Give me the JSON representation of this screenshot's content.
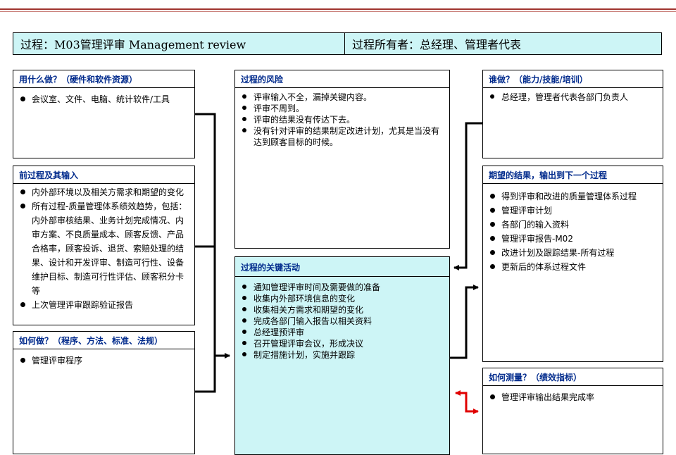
{
  "header": {
    "process": "过程：M03管理评审 Management review",
    "owner": "过程所有者：总经理、管理者代表"
  },
  "boxes": {
    "resources": {
      "title": "用什么做？（硬件和软件资源）",
      "items": [
        "会议室、文件、电脑、统计软件/工具"
      ]
    },
    "inputs": {
      "title": "前过程及其输入",
      "items": [
        "内外部环境以及相关方需求和期望的变化",
        "所有过程-质量管理体系绩效趋势，包括：内外部审核结果、业务计划完成情况、内审方案、不良质量成本、顾客反馈、产品合格率，顾客投诉、退货、索赔处理的结果、设计和开发评审、制造可行性、设备维护目标、制造可行性评估、顾客积分卡等",
        "上次管理评审跟踪验证报告"
      ]
    },
    "how": {
      "title": "如何做？（程序、方法、标准、法规）",
      "items": [
        "管理评审程序"
      ]
    },
    "risks": {
      "title": "过程的风险",
      "items": [
        "评审输入不全，漏掉关键内容。",
        "评审不周到。",
        "评审的结果没有传达下去。",
        "没有针对评审的结果制定改进计划，尤其是当没有达到顾客目标的时候。"
      ]
    },
    "activities": {
      "title": "过程的关键活动",
      "items": [
        "通知管理评审时间及需要做的准备",
        "收集内外部环境信息的变化",
        "收集相关方需求和期望的变化",
        "完成各部门输入报告以相关资料",
        "总经理预评审",
        "召开管理评审会议，形成决议",
        "制定措施计划，实施并跟踪"
      ]
    },
    "who": {
      "title": "谁做？（能力/技能/培训）",
      "items": [
        "总经理，管理者代表各部门负责人"
      ]
    },
    "outputs": {
      "title": "期望的结果，输出到下一个过程",
      "items": [
        "得到评审和改进的质量管理体系过程",
        "管理评审计划",
        "各部门的输入资料",
        "管理评审报告-M02",
        "改进计划及跟踪结果-所有过程",
        "更新后的体系过程文件"
      ]
    },
    "measure": {
      "title": "如何测量？（绩效指标）",
      "items": [
        "管理评审输出结果完成率"
      ]
    }
  },
  "colors": {
    "title_bg": "#cdf5f6",
    "heading_text": "#002a8c",
    "connector": "#000000",
    "measure_connector": "#e00000",
    "top_rule": "#a0342e"
  }
}
